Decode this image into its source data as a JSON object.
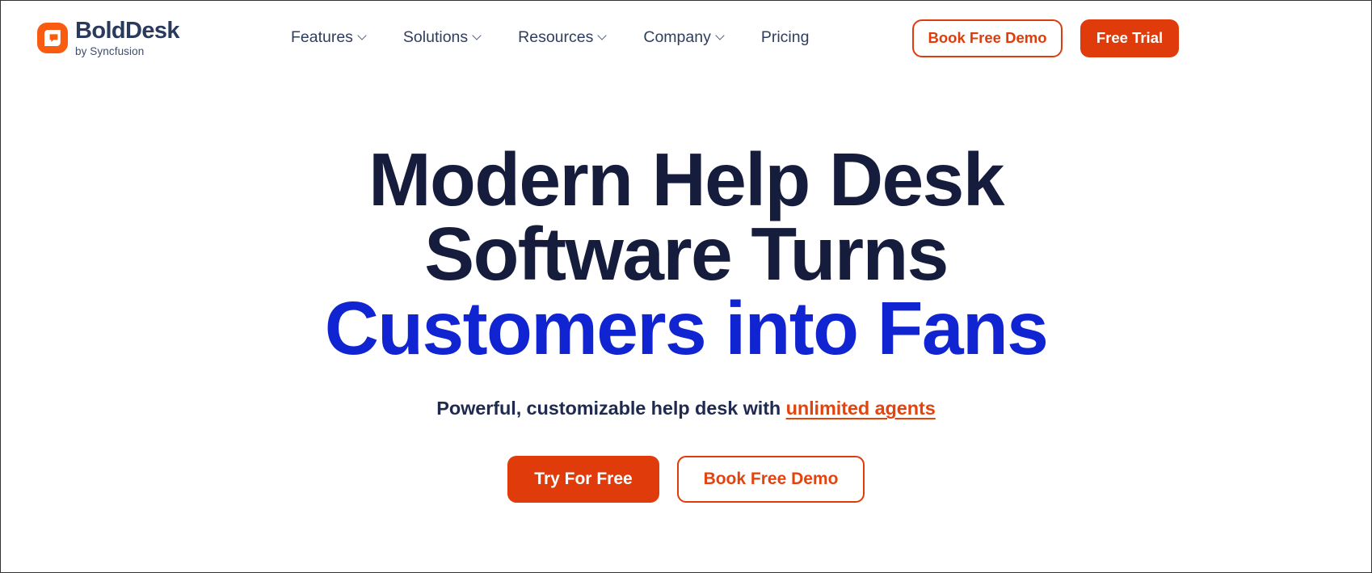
{
  "brand": {
    "logo_icon": "bolddesk-chat-bubble-icon",
    "name": "BoldDesk",
    "tagline": "by Syncfusion",
    "accent_orange": "#E03C0B",
    "accent_blue": "#1124D2",
    "navy": "#161C3C"
  },
  "header": {
    "nav": [
      {
        "label": "Features",
        "has_dropdown": true,
        "icon": "chevron-down-icon"
      },
      {
        "label": "Solutions",
        "has_dropdown": true,
        "icon": "chevron-down-icon"
      },
      {
        "label": "Resources",
        "has_dropdown": true,
        "icon": "chevron-down-icon"
      },
      {
        "label": "Company",
        "has_dropdown": true,
        "icon": "chevron-down-icon"
      },
      {
        "label": "Pricing",
        "has_dropdown": false,
        "icon": ""
      }
    ],
    "book_demo_label": "Book Free Demo",
    "free_trial_label": "Free Trial"
  },
  "hero": {
    "title_line1": "Modern Help Desk",
    "title_line2": "Software Turns",
    "title_line3": "Customers into Fans",
    "subtitle_prefix": "Powerful, customizable help desk with ",
    "subtitle_link": "unlimited agents",
    "cta_primary": "Try For Free",
    "cta_secondary": "Book Free Demo"
  }
}
